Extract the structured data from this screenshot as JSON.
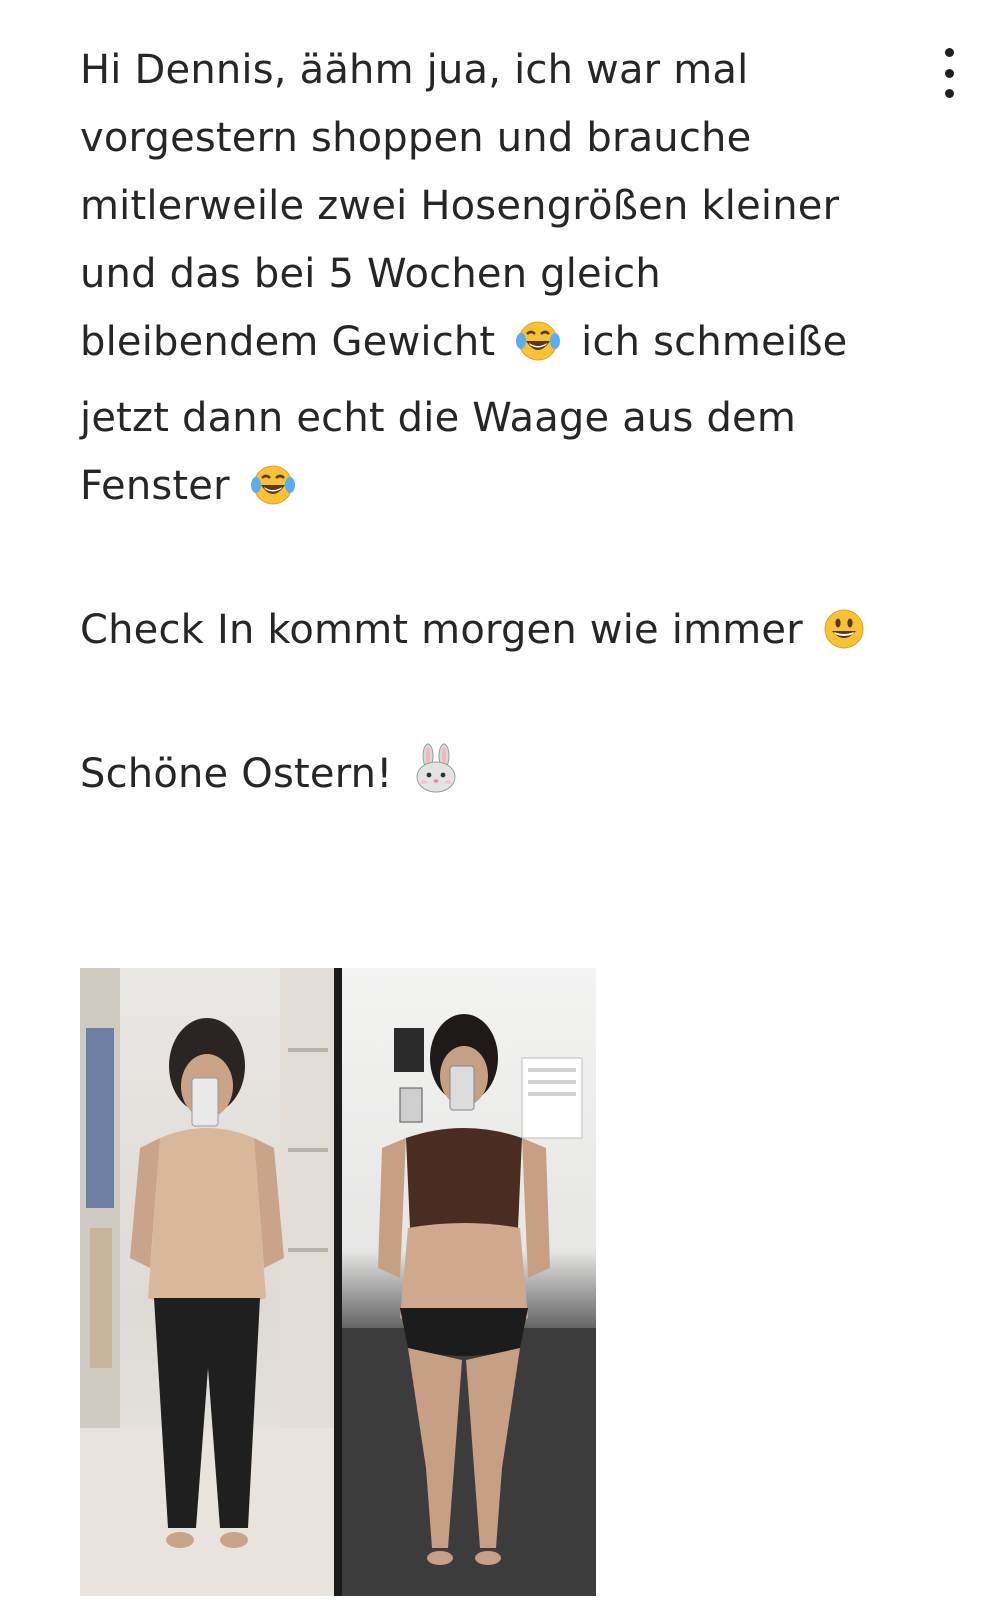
{
  "message": {
    "paragraphs": [
      {
        "parts": [
          "Hi Dennis, äähm jua, ich war mal vorgestern shoppen und brauche mitlerweile zwei Hosengrößen kleiner und das bei 5 Wochen gleich bleibendem Gewicht",
          "ich schmeiße jetzt dann echt die Waage aus dem Fenster",
          ""
        ],
        "emojis": [
          "face-with-tears-of-joy-icon",
          "face-with-tears-of-joy-icon"
        ]
      },
      {
        "parts": [
          "Check In kommt morgen wie immer",
          ""
        ],
        "emojis": [
          "grinning-face-icon"
        ]
      },
      {
        "parts": [
          "Schöne Ostern!",
          ""
        ],
        "emojis": [
          "rabbit-face-icon"
        ]
      }
    ]
  },
  "menu": {
    "icon": "more-vertical-icon"
  },
  "attachment": {
    "type": "before-after-photo",
    "panels": [
      {
        "name": "photo-after",
        "background": "#e4e1dc"
      },
      {
        "name": "photo-before",
        "background": "#efefee"
      }
    ]
  },
  "colors": {
    "text": "#262626",
    "emoji_yellow": "#f7c236",
    "emoji_tear": "#5aaef0"
  }
}
